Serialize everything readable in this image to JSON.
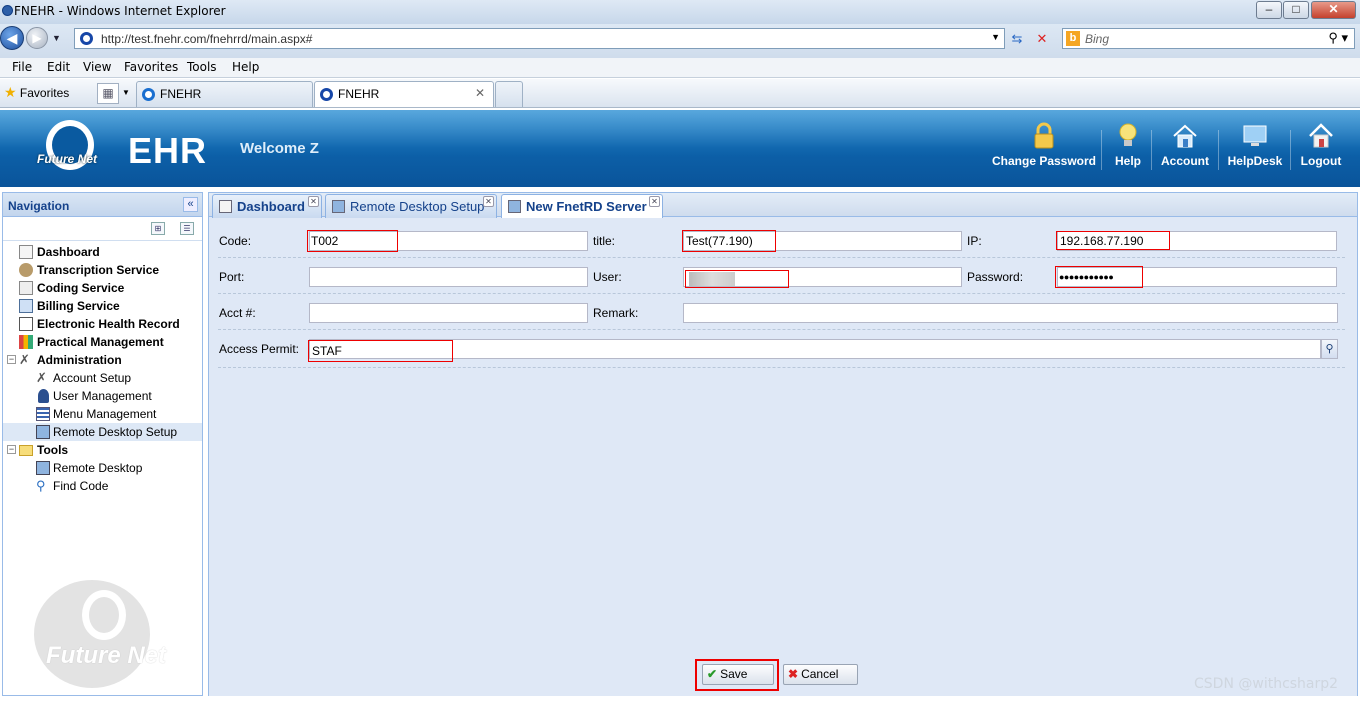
{
  "window": {
    "title": "FNEHR - Windows Internet Explorer",
    "min": "–",
    "max": "□",
    "close": "✕"
  },
  "address": {
    "url": "http://test.fnehr.com/fnehrrd/main.aspx#",
    "search_placeholder": "Bing"
  },
  "menu": [
    "File",
    "Edit",
    "View",
    "Favorites",
    "Tools",
    "Help"
  ],
  "favorites_label": "Favorites",
  "browser_tabs": [
    {
      "label": "FNEHR",
      "active": false
    },
    {
      "label": "FNEHR",
      "active": true
    }
  ],
  "header": {
    "logo_text": "Future Net",
    "app_name": "EHR",
    "welcome": "Welcome Z",
    "buttons": [
      {
        "label": "Change Password",
        "icon": "lock-icon"
      },
      {
        "label": "Help",
        "icon": "lightbulb-icon"
      },
      {
        "label": "Account",
        "icon": "house-icon"
      },
      {
        "label": "HelpDesk",
        "icon": "monitor-icon"
      },
      {
        "label": "Logout",
        "icon": "home-exit-icon"
      }
    ]
  },
  "navigation": {
    "title": "Navigation",
    "collapse": "«",
    "tree": [
      {
        "label": "Dashboard",
        "bold": true,
        "level": 0
      },
      {
        "label": "Transcription Service",
        "bold": true,
        "level": 0
      },
      {
        "label": "Coding Service",
        "bold": true,
        "level": 0
      },
      {
        "label": "Billing Service",
        "bold": true,
        "level": 0
      },
      {
        "label": "Electronic Health Record",
        "bold": true,
        "level": 0
      },
      {
        "label": "Practical Management",
        "bold": true,
        "level": 0
      },
      {
        "label": "Administration",
        "bold": true,
        "level": 0,
        "expanded": true
      },
      {
        "label": "Account Setup",
        "bold": false,
        "level": 1
      },
      {
        "label": "User Management",
        "bold": false,
        "level": 1
      },
      {
        "label": "Menu Management",
        "bold": false,
        "level": 1
      },
      {
        "label": "Remote Desktop Setup",
        "bold": false,
        "level": 1,
        "selected": true
      },
      {
        "label": "Tools",
        "bold": true,
        "level": 0,
        "expanded": true
      },
      {
        "label": "Remote Desktop",
        "bold": false,
        "level": 1
      },
      {
        "label": "Find Code",
        "bold": false,
        "level": 1
      }
    ],
    "watermark": "Future Net"
  },
  "panel_tabs": [
    {
      "label": "Dashboard",
      "active": false
    },
    {
      "label": "Remote Desktop Setup",
      "active": false
    },
    {
      "label": "New FnetRD Server",
      "active": true
    }
  ],
  "form": {
    "code_label": "Code:",
    "code_value": "T002",
    "title_label": "title:",
    "title_value": "Test(77.190)",
    "ip_label": "IP:",
    "ip_value": "192.168.77.190",
    "port_label": "Port:",
    "port_value": "",
    "user_label": "User:",
    "user_value": "",
    "password_label": "Password:",
    "password_value": "●●●●●●●●●●●",
    "acct_label": "Acct #:",
    "acct_value": "",
    "remark_label": "Remark:",
    "remark_value": "",
    "access_label": "Access Permit:",
    "access_value": "STAF"
  },
  "buttons": {
    "save": "Save",
    "cancel": "Cancel"
  },
  "watermark_credit": "CSDN @withcsharp2"
}
